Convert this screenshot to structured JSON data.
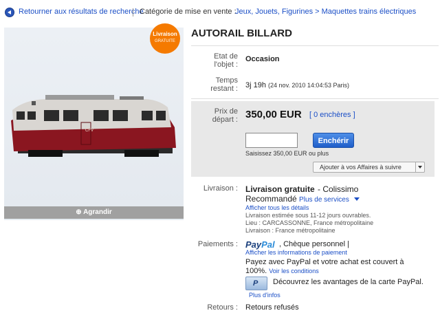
{
  "breadcrumb": {
    "back_label": "Retourner aux résultats de recherche",
    "category_label": "Catégorie de mise en vente :",
    "category_path": "Jeux, Jouets, Figurines > Maquettes trains électriques"
  },
  "photo": {
    "badge_line1": "Livraison",
    "badge_line2": "GRATUITE",
    "enlarge_label": "Agrandir",
    "train_marking": "CFV"
  },
  "item": {
    "title": "AUTORAIL BILLARD"
  },
  "details": {
    "state_label_line1": "Etat de",
    "state_label_line2": "l'objet :",
    "state_value": "Occasion",
    "time_label_line1": "Temps",
    "time_label_line2": "restant :",
    "time_value": "3j 19h",
    "time_detail": "(24 nov. 2010 14:04:53 Paris)"
  },
  "price": {
    "label_line1": "Prix de",
    "label_line2": "départ :",
    "amount": "350,00 EUR",
    "bids": "[ 0 enchères ]",
    "bid_input_value": "",
    "bid_button": "Enchérir",
    "bid_hint": "Saisissez 350,00 EUR ou plus",
    "watch_label": "Ajouter à vos Affaires à suivre"
  },
  "shipping": {
    "label": "Livraison :",
    "title": "Livraison gratuite",
    "service": "- Colissimo",
    "service_line2": "Recommandé",
    "more_services": "Plus de services",
    "show_details": "Afficher tous les détails",
    "estimate": "Livraison estimée sous 11-12 jours ouvrables.",
    "location": "Lieu : CARCASSONNE, France métropolitaine",
    "delivery": "Livraison : France métropolitaine"
  },
  "payment": {
    "label": "Paiements :",
    "paypal_part1": "Pay",
    "paypal_part2": "Pal",
    "other_methods": ", Chèque personnel |",
    "show_info": "Afficher les informations de paiement",
    "coverage_text": "Payez avec PayPal et votre achat est couvert à 100%.",
    "conditions_link": "Voir les conditions",
    "card_text": "Découvrez les avantages de la carte PayPal.",
    "more_info": "Plus d'infos"
  },
  "returns": {
    "label": "Retours :",
    "value": "Retours refusés"
  },
  "colors": {
    "link": "#1a4ec6",
    "badge": "#f57a00",
    "bid_button": "#1f5ec9",
    "price_box": "#e8e8e8",
    "train_red": "#8a1620"
  }
}
